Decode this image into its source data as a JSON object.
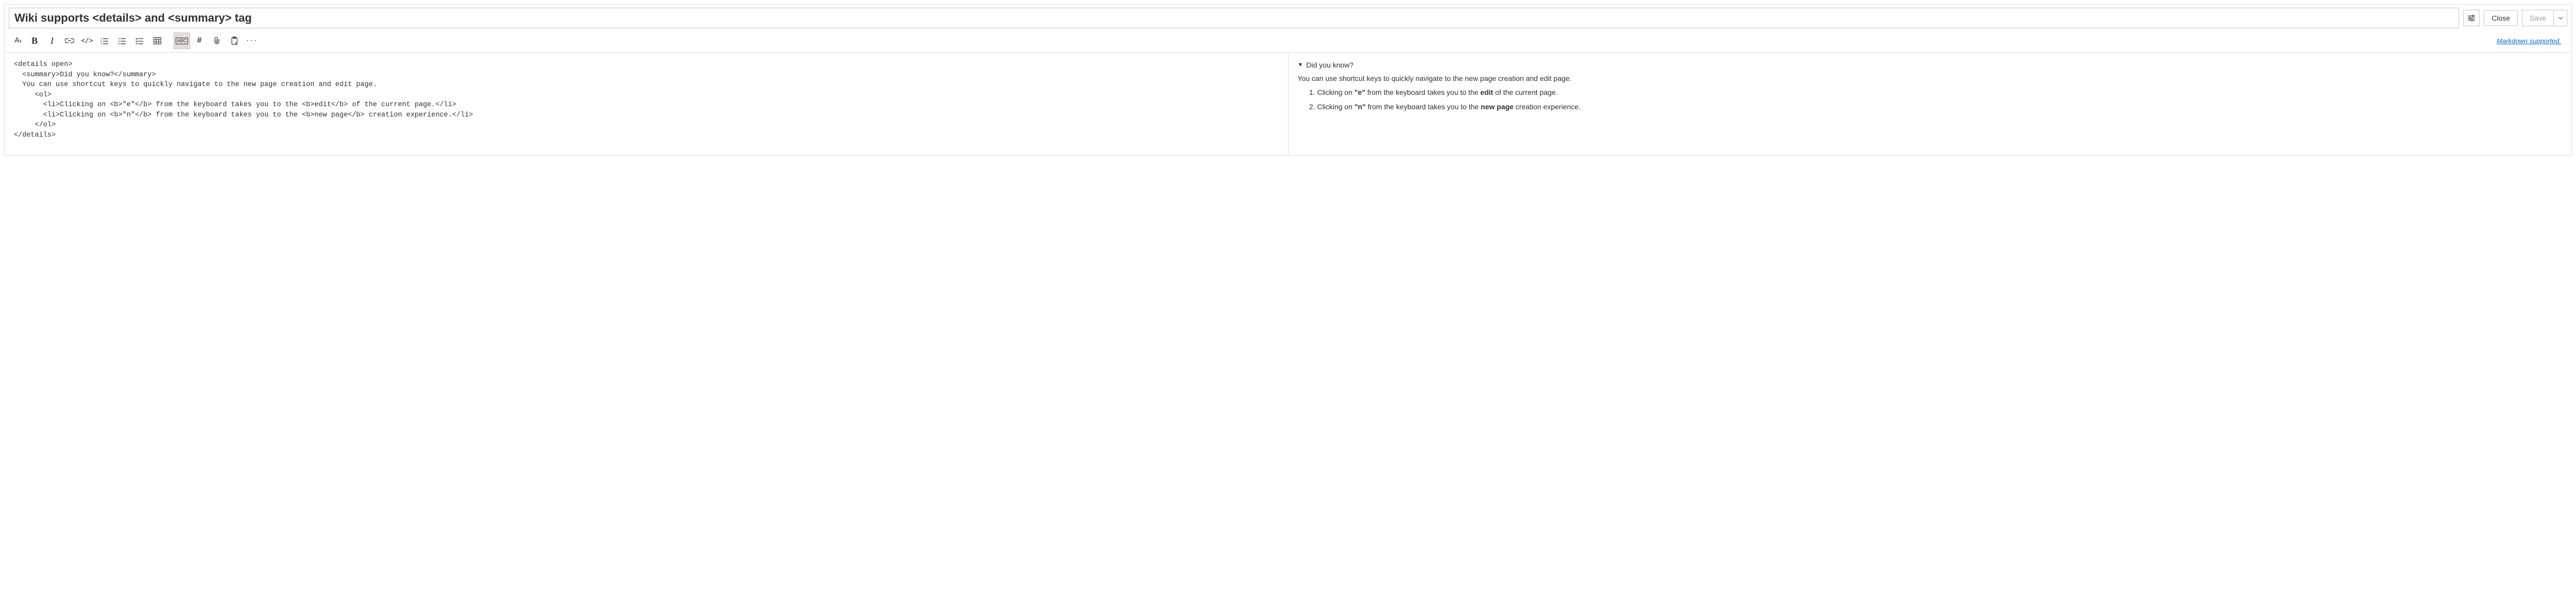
{
  "title": "Wiki supports <details> and <summary> tag",
  "buttons": {
    "settings_title": "Page settings",
    "close": "Close",
    "save": "Save"
  },
  "toolbar": {
    "font_color": "Font color",
    "bold": "B",
    "italic": "I",
    "link": "Link",
    "code": "</>",
    "ol": "Numbered list",
    "ul": "Bulleted list",
    "checklist": "Checklist",
    "table": "Table",
    "highlight_label": "ABC",
    "hash": "#",
    "attach": "Attach",
    "paste": "Paste",
    "more": "···"
  },
  "markdown_link": "Markdown supported.",
  "editor": {
    "lines": [
      "<details open>",
      "  <summary>Did you know?</summary>",
      "  You can use shortcut keys to quickly navigate to the new page creation and edit page.",
      "     <ol>",
      "       <li>Clicking on <b>\"e\"</b> from the keyboard takes you to the <b>edit</b> of the current page.</li>",
      "       <li>Clicking on <b>\"n\"</b> from the keyboard takes you to the <b>new page</b> creation experience.</li>",
      "     </ol>",
      "</details>"
    ]
  },
  "preview": {
    "summary": "Did you know?",
    "intro": "You can use shortcut keys to quickly navigate to the new page creation and edit page.",
    "item1_pre": "Clicking on ",
    "item1_key": "\"e\"",
    "item1_mid": " from the keyboard takes you to the ",
    "item1_bold": "edit",
    "item1_post": " of the current page.",
    "item2_pre": "Clicking on ",
    "item2_key": "\"n\"",
    "item2_mid": " from the keyboard takes you to the ",
    "item2_bold": "new page",
    "item2_post": " creation experience."
  }
}
